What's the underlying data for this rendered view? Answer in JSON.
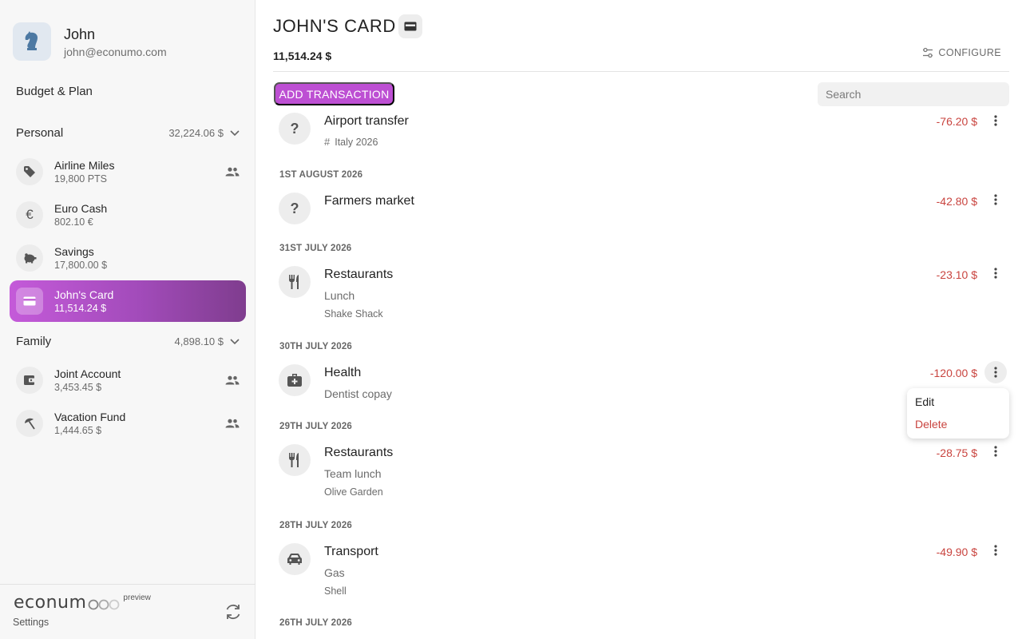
{
  "user": {
    "name": "John",
    "email": "john@econumo.com"
  },
  "nav": {
    "budget_label": "Budget & Plan"
  },
  "groups": [
    {
      "title": "Personal",
      "total": "32,224.06 $",
      "accounts": [
        {
          "name": "Airline Miles",
          "balance": "19,800 PTS",
          "icon": "tag-icon",
          "shared": true
        },
        {
          "name": "Euro Cash",
          "balance": "802.10 €",
          "icon": "euro-icon",
          "shared": false
        },
        {
          "name": "Savings",
          "balance": "17,800.00 $",
          "icon": "piggy-bank-icon",
          "shared": false
        },
        {
          "name": "John's Card",
          "balance": "11,514.24 $",
          "icon": "credit-card-icon",
          "shared": false,
          "active": true
        }
      ]
    },
    {
      "title": "Family",
      "total": "4,898.10 $",
      "accounts": [
        {
          "name": "Joint Account",
          "balance": "3,453.45 $",
          "icon": "wallet-icon",
          "shared": true
        },
        {
          "name": "Vacation Fund",
          "balance": "1,444.65 $",
          "icon": "beach-umbrella-icon",
          "shared": true
        }
      ]
    }
  ],
  "footer": {
    "logo_text": "econum",
    "logo_tag": "preview",
    "settings_label": "Settings"
  },
  "header": {
    "title": "JOHN'S CARD",
    "balance": "11,514.24 $",
    "configure_label": "CONFIGURE",
    "add_transaction_label": "ADD TRANSACTION",
    "search_placeholder": "Search"
  },
  "transactions": [
    {
      "category": "Airport transfer",
      "tag": "Italy 2026",
      "amount": "-76.20 $",
      "icon": "question-icon"
    },
    {
      "date": "1ST AUGUST 2026"
    },
    {
      "category": "Farmers market",
      "amount": "-42.80 $",
      "icon": "question-icon"
    },
    {
      "date": "31ST JULY 2026"
    },
    {
      "category": "Restaurants",
      "description": "Lunch",
      "payee": "Shake Shack",
      "amount": "-23.10 $",
      "icon": "fork-knife-icon"
    },
    {
      "date": "30TH JULY 2026"
    },
    {
      "category": "Health",
      "description": "Dentist copay",
      "amount": "-120.00 $",
      "icon": "medical-kit-icon",
      "menu_open": true
    },
    {
      "date": "29TH JULY 2026"
    },
    {
      "category": "Restaurants",
      "description": "Team lunch",
      "payee": "Olive Garden",
      "amount": "-28.75 $",
      "icon": "fork-knife-icon"
    },
    {
      "date": "28TH JULY 2026"
    },
    {
      "category": "Transport",
      "description": "Gas",
      "payee": "Shell",
      "amount": "-49.90 $",
      "icon": "car-icon"
    },
    {
      "date": "26TH JULY 2026"
    }
  ],
  "context_menu": {
    "edit_label": "Edit",
    "delete_label": "Delete"
  },
  "colors": {
    "accent": "#bd4fd3",
    "negative": "#c9443f",
    "sidebar_bg": "#f7f7f7"
  }
}
